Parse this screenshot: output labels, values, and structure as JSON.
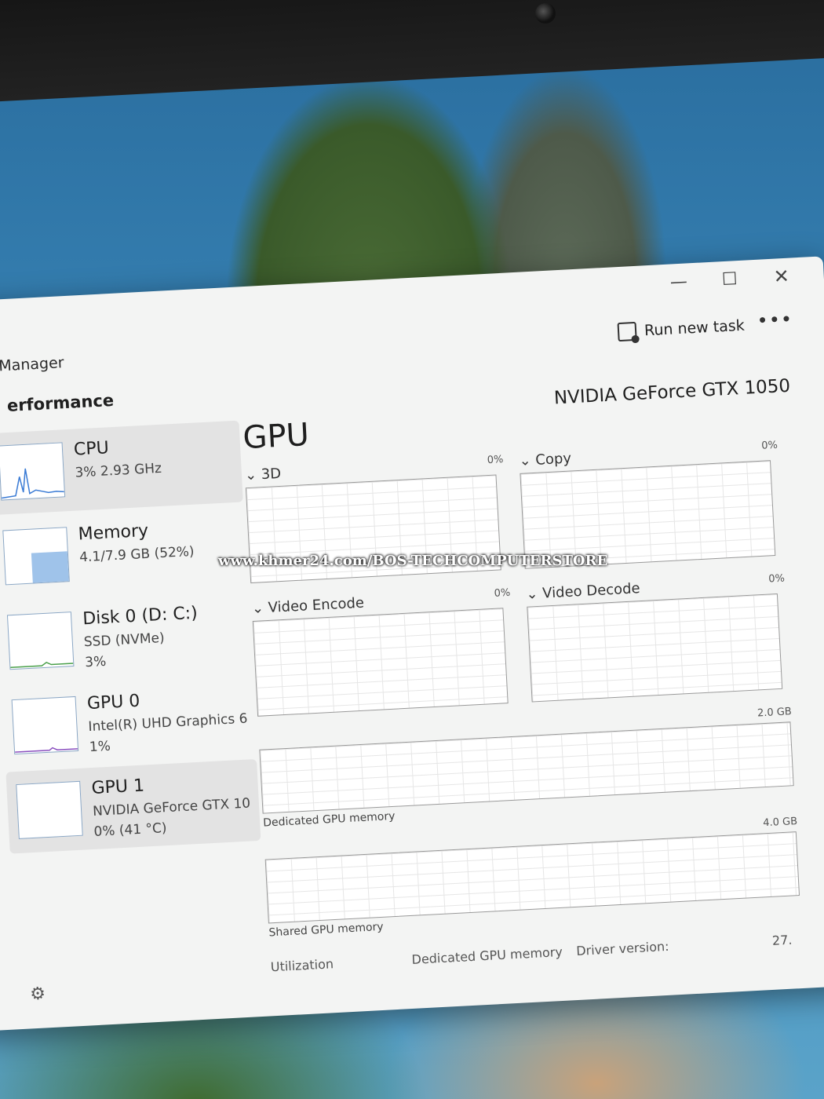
{
  "window": {
    "title": "Manager",
    "controls": {
      "minimize": "—",
      "maximize": "☐",
      "close": "✕"
    }
  },
  "toolbar": {
    "run_new_task": "Run new task",
    "more": "•••"
  },
  "section": {
    "title": "erformance"
  },
  "sidebar": {
    "items": [
      {
        "name": "CPU",
        "line2": "3% 2.93 GHz",
        "line3": ""
      },
      {
        "name": "Memory",
        "line2": "4.1/7.9 GB (52%)",
        "line3": ""
      },
      {
        "name": "Disk 0 (D: C:)",
        "line2": "SSD (NVMe)",
        "line3": "3%"
      },
      {
        "name": "GPU 0",
        "line2": "Intel(R) UHD Graphics 6",
        "line3": "1%"
      },
      {
        "name": "GPU 1",
        "line2": "NVIDIA GeForce GTX 10",
        "line3": "0% (41 °C)"
      }
    ]
  },
  "main": {
    "title": "GPU",
    "model": "NVIDIA GeForce GTX 1050",
    "graphs": [
      {
        "label": "3D",
        "pct": "0%"
      },
      {
        "label": "Copy",
        "pct": "0%"
      },
      {
        "label": "Video Encode",
        "pct": "0%"
      },
      {
        "label": "Video Decode",
        "pct": "0%"
      }
    ],
    "dedicated_memory": {
      "label": "Dedicated GPU memory",
      "max": "2.0 GB"
    },
    "shared_memory": {
      "label": "Shared GPU memory",
      "max": "4.0 GB"
    },
    "stats": {
      "utilization": "Utilization",
      "dedicated": "Dedicated GPU memory",
      "driver": "Driver version:",
      "driver_value": "27."
    }
  },
  "watermark": "www.khmer24.com/BOS-TECHCOMPUTERSTORE"
}
